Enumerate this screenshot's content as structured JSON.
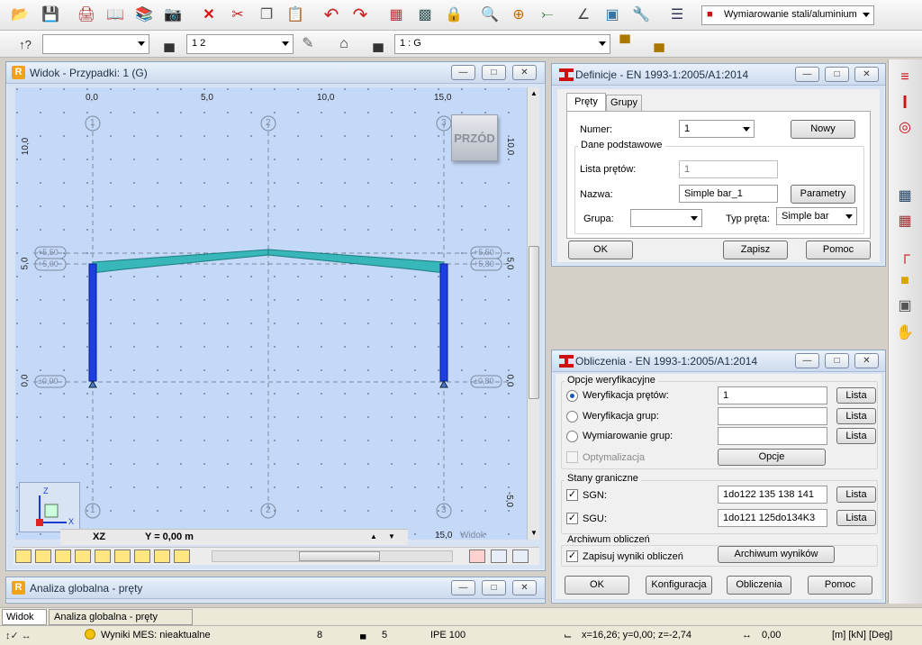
{
  "toolbar1": {
    "module_combo": "Wymiarowanie stali/aluminium",
    "icons": [
      "open-icon",
      "save-icon",
      "print-icon",
      "print-preview-icon",
      "book-icon",
      "screenshot-icon",
      "delete-icon",
      "cut-icon",
      "copy-icon",
      "paste-icon",
      "undo-icon",
      "redo-icon",
      "table-icon",
      "table-edit-icon",
      "lock-icon",
      "zoom-icon",
      "zoom-window-icon",
      "axes-icon",
      "dimension-icon",
      "cube-icon",
      "tools-icon",
      "results-icon"
    ]
  },
  "toolbar2": {
    "combo1": "",
    "combo2": "1 2",
    "combo3": "1 : G"
  },
  "view_window": {
    "title": "Widok - Przypadki: 1 (G)",
    "top_ticks": [
      "0,0",
      "5,0",
      "10,0",
      "15,0"
    ],
    "side_ticks": [
      "10,0",
      "5,0",
      "0,0",
      "-5,0"
    ],
    "grid_markers": [
      "1",
      "2",
      "3"
    ],
    "level_labels_left": [
      "+5,50",
      "+5,00",
      "±0,00"
    ],
    "level_labels_right": [
      "+5,50",
      "+5,80",
      "±0,80"
    ],
    "cube_label": "PRZÓD",
    "status_plane": "XZ",
    "status_coord": "Y = 0,00 m",
    "corner_label": "15,0",
    "corner_sublabel": "Widok",
    "axis_z": "Z",
    "axis_x": "X"
  },
  "analysis_window": {
    "title": "Analiza globalna - pręty"
  },
  "definicje": {
    "title": "Definicje - EN 1993-1:2005/A1:2014",
    "tabs": [
      "Pręty",
      "Grupy"
    ],
    "numer_label": "Numer:",
    "numer_value": "1",
    "nowy_button": "Nowy",
    "group_title": "Dane podstawowe",
    "lista_label": "Lista prętów:",
    "lista_value": "1",
    "nazwa_label": "Nazwa:",
    "nazwa_value": "Simple bar_1",
    "parametry_button": "Parametry",
    "grupa_label": "Grupa:",
    "grupa_value": "",
    "typ_label": "Typ pręta:",
    "typ_value": "Simple bar",
    "ok_button": "OK",
    "zapisz_button": "Zapisz",
    "pomoc_button": "Pomoc"
  },
  "obliczenia": {
    "title": "Obliczenia - EN 1993-1:2005/A1:2014",
    "opcje_title": "Opcje weryfikacyjne",
    "radio_bars": "Weryfikacja prętów:",
    "radio_bars_value": "1",
    "radio_groups": "Weryfikacja grup:",
    "radio_design": "Wymiarowanie grup:",
    "optim_label": "Optymalizacja",
    "opcje_button": "Opcje",
    "lista_button": "Lista",
    "stany_title": "Stany graniczne",
    "sgn_label": "SGN:",
    "sgn_value": "1do122 135 138 141",
    "sgu_label": "SGU:",
    "sgu_value": "1do121 125do134K3",
    "archiwum_title": "Archiwum obliczeń",
    "zapisuj_label": "Zapisuj wyniki obliczeń",
    "archiwum_button": "Archiwum wyników",
    "ok_button": "OK",
    "konfig_button": "Konfiguracja",
    "oblicz_button": "Obliczenia",
    "pomoc_button": "Pomoc"
  },
  "bottom_tabs": [
    "Widok",
    "Analiza globalna - pręty"
  ],
  "statusbar": {
    "mes": "Wyniki MES: nieaktualne",
    "num1": "8",
    "num2": "5",
    "section": "IPE 100",
    "coords": "x=16,26; y=0,00; z=-2,74",
    "angle": "0,00",
    "units": "[m] [kN] [Deg]"
  },
  "colors": {
    "column": "#1b3fe0",
    "rafter": "#37b7b9",
    "viewport": "#c4d8f7"
  }
}
